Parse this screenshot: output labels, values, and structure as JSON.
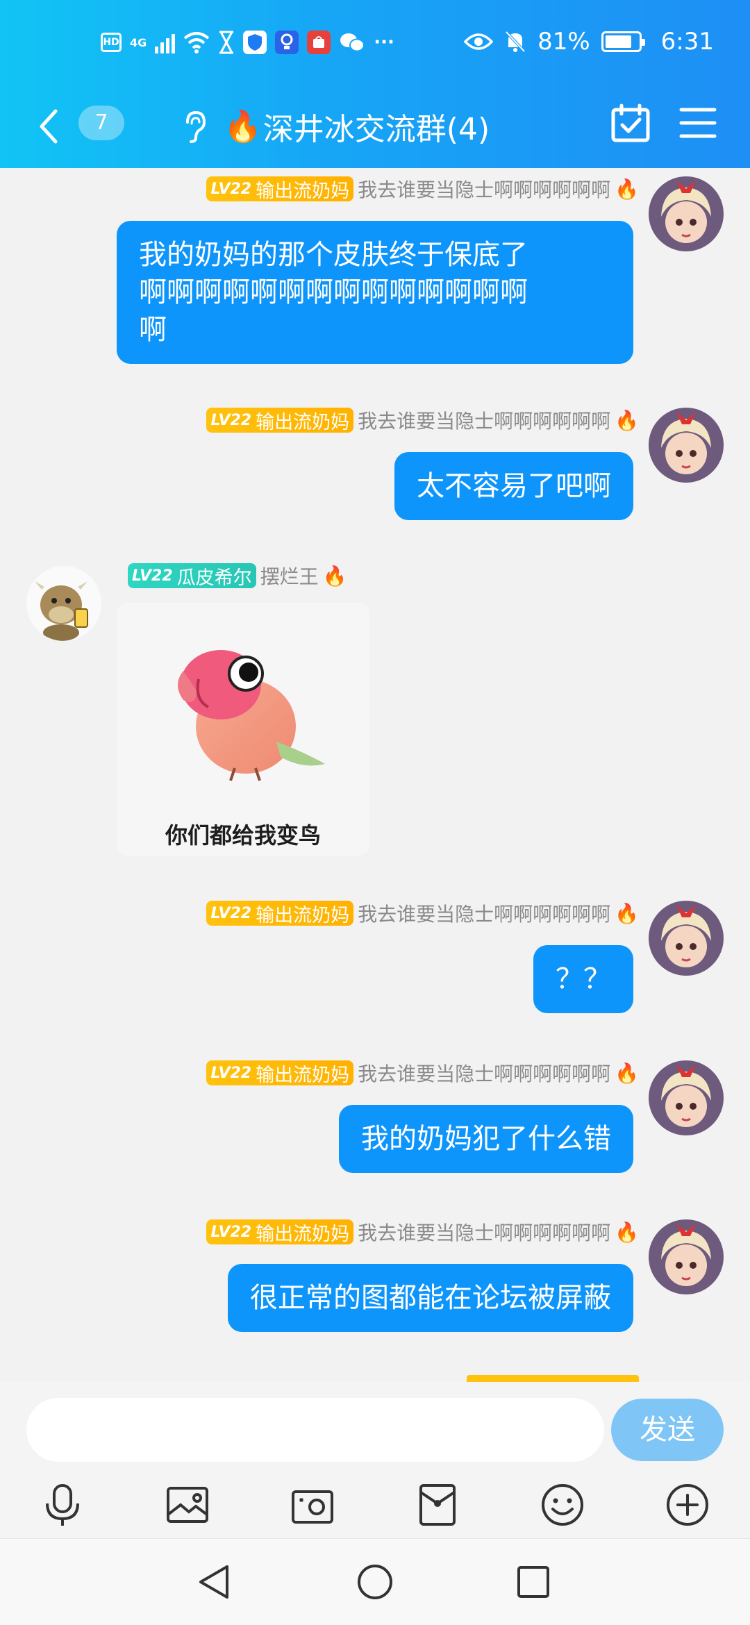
{
  "status_bar": {
    "hd_label": "HD",
    "network_label": "4G",
    "more_label": "···",
    "battery_text": "81%",
    "battery_level": 0.81,
    "time": "6:31"
  },
  "header": {
    "unread_count": "7",
    "title_emoji": "🔥",
    "title": "深井冰交流群(4)"
  },
  "messages": [
    {
      "sender": "me",
      "level": "LV22",
      "nickname": "输出流奶妈",
      "member_title": "我去谁要当隐士啊啊啊啊啊啊",
      "emoji": "🔥",
      "text_lines": [
        "我的奶妈的那个皮肤终于保底了",
        "啊啊啊啊啊啊啊啊啊啊啊啊啊啊",
        "啊"
      ]
    },
    {
      "sender": "me",
      "level": "LV22",
      "nickname": "输出流奶妈",
      "member_title": "我去谁要当隐士啊啊啊啊啊啊",
      "emoji": "🔥",
      "text_lines": [
        "太不容易了吧啊"
      ]
    },
    {
      "sender": "other",
      "level": "LV22",
      "nickname": "瓜皮希尔",
      "member_title": "摆烂王",
      "emoji": "🔥",
      "sticker_caption": "你们都给我变鸟"
    },
    {
      "sender": "me",
      "level": "LV22",
      "nickname": "输出流奶妈",
      "member_title": "我去谁要当隐士啊啊啊啊啊啊",
      "emoji": "🔥",
      "text_lines": [
        "？？"
      ]
    },
    {
      "sender": "me",
      "level": "LV22",
      "nickname": "输出流奶妈",
      "member_title": "我去谁要当隐士啊啊啊啊啊啊",
      "emoji": "🔥",
      "text_lines": [
        "我的奶妈犯了什么错"
      ]
    },
    {
      "sender": "me",
      "level": "LV22",
      "nickname": "输出流奶妈",
      "member_title": "我去谁要当隐士啊啊啊啊啊啊",
      "emoji": "🔥",
      "text_lines": [
        "很正常的图都能在论坛被屏蔽"
      ]
    }
  ],
  "input": {
    "placeholder": "",
    "send_label": "发送"
  },
  "toolbar": {
    "icons": [
      "microphone-icon",
      "picture-icon",
      "camera-icon",
      "red-packet-icon",
      "emoji-icon",
      "plus-icon"
    ]
  },
  "colors": {
    "header_gradient_start": "#11c4f5",
    "header_gradient_end": "#1e8ff5",
    "bubble": "#0e95fb",
    "send_button": "#7fc6f7",
    "gold_badge": "#ffb100",
    "teal_badge": "#27c6b5"
  }
}
